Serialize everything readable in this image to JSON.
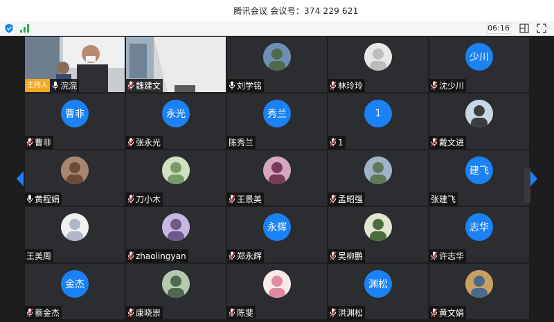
{
  "window": {
    "title": "腾讯会议  会议号：374 229 621"
  },
  "toolbar": {
    "timer": "06:16",
    "icons": [
      "shield-icon",
      "signal-icon",
      "layout-icon",
      "fullscreen-icon"
    ]
  },
  "colors": {
    "accent": "#1a82f5",
    "host_badge": "#f5a623",
    "tile_bg": "#2b2d31",
    "mic_muted": "#e64340"
  },
  "host_badge": "主持人",
  "participants": [
    {
      "name": "浣浣",
      "kind": "video",
      "mic": "on",
      "host": true
    },
    {
      "name": "魏建文",
      "kind": "video",
      "mic": "muted"
    },
    {
      "name": "刘学铭",
      "kind": "photo",
      "mic": "on"
    },
    {
      "name": "林玲玲",
      "kind": "photo",
      "mic": "muted"
    },
    {
      "name": "沈少川",
      "kind": "text",
      "avatar": "少川",
      "mic": "muted"
    },
    {
      "name": "曹非",
      "kind": "text",
      "avatar": "曹非",
      "mic": "muted"
    },
    {
      "name": "张永光",
      "kind": "text",
      "avatar": "永光",
      "mic": "muted"
    },
    {
      "name": "陈秀兰",
      "kind": "text",
      "avatar": "秀兰",
      "mic": "none"
    },
    {
      "name": "1",
      "kind": "text",
      "avatar": "1",
      "mic": "muted"
    },
    {
      "name": "戴文进",
      "kind": "photo",
      "mic": "muted"
    },
    {
      "name": "黄程娟",
      "kind": "photo",
      "mic": "on"
    },
    {
      "name": "刀小木",
      "kind": "photo",
      "mic": "muted"
    },
    {
      "name": "王景美",
      "kind": "photo",
      "mic": "muted"
    },
    {
      "name": "孟昭强",
      "kind": "photo",
      "mic": "muted"
    },
    {
      "name": "张建飞",
      "kind": "text",
      "avatar": "建飞",
      "mic": "none"
    },
    {
      "name": "王美周",
      "kind": "photo",
      "mic": "none"
    },
    {
      "name": "zhaolingyan",
      "kind": "photo",
      "mic": "muted"
    },
    {
      "name": "郑永辉",
      "kind": "text",
      "avatar": "永辉",
      "mic": "muted"
    },
    {
      "name": "吴柳鹏",
      "kind": "photo",
      "mic": "muted"
    },
    {
      "name": "许志华",
      "kind": "text",
      "avatar": "志华",
      "mic": "muted"
    },
    {
      "name": "蔡金杰",
      "kind": "text",
      "avatar": "金杰",
      "mic": "muted"
    },
    {
      "name": "康晓崇",
      "kind": "photo",
      "mic": "muted"
    },
    {
      "name": "陈斐",
      "kind": "photo",
      "mic": "muted"
    },
    {
      "name": "洪渊松",
      "kind": "text",
      "avatar": "渊松",
      "mic": "muted"
    },
    {
      "name": "黄文娟",
      "kind": "photo",
      "mic": "muted"
    }
  ]
}
